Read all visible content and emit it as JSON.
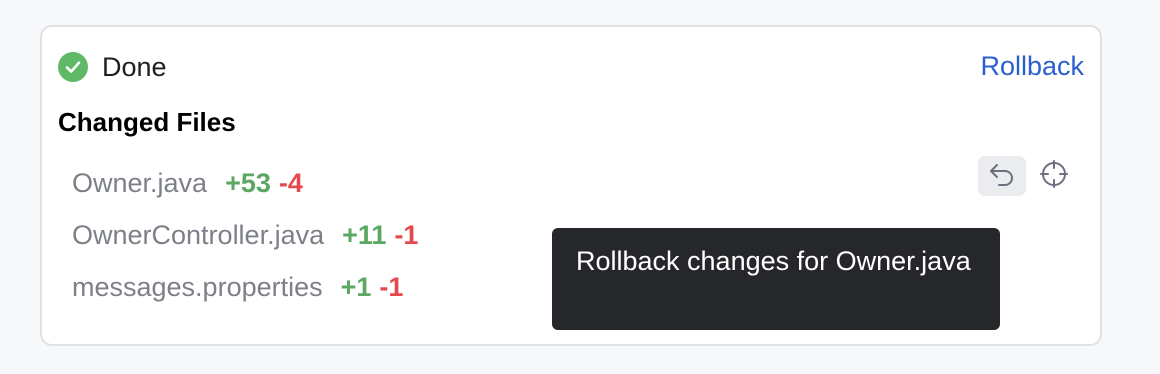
{
  "status": {
    "label": "Done",
    "icon": "check-circle-icon",
    "color": "#5fb865"
  },
  "rollback_link": {
    "label": "Rollback",
    "color": "#2b5fd0"
  },
  "changed_files": {
    "title": "Changed Files",
    "files": [
      {
        "name": "Owner.java",
        "added": "+53",
        "removed": "-4"
      },
      {
        "name": "OwnerController.java",
        "added": "+11",
        "removed": "-1"
      },
      {
        "name": "messages.properties",
        "added": "+1",
        "removed": "-1"
      }
    ]
  },
  "row_actions": {
    "undo_icon": "undo-icon",
    "locate_icon": "crosshair-icon"
  },
  "tooltip": {
    "text": "Rollback changes for Owner.java"
  },
  "colors": {
    "added": "#5aa863",
    "removed": "#e5484d"
  }
}
